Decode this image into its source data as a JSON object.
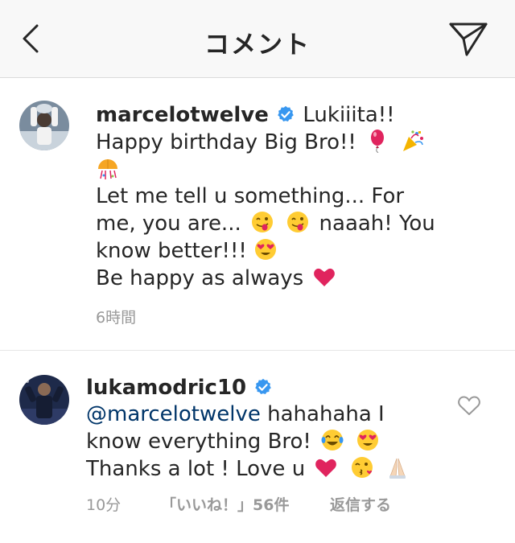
{
  "header": {
    "title": "コメント",
    "back_icon": "chevron-left-icon",
    "send_icon": "paper-plane-icon"
  },
  "colors": {
    "header_bg": "#f8f8f8",
    "text": "#262626",
    "meta": "#999999",
    "mention": "#003569",
    "verified": "#3897f0",
    "heart": "#e0245e"
  },
  "comments": [
    {
      "username": "marcelotwelve",
      "verified": true,
      "lines": [
        "Lukiiita!!",
        "Happy birthday Big Bro!!",
        "Let me tell u something... For",
        "me, you are...",
        "naaah! You",
        "know better!!!",
        "Be happy as always"
      ],
      "emojis": [
        "balloon",
        "party-popper",
        "confetti-ball",
        "winking-tongue-face",
        "winking-tongue-face",
        "heart-eyes-face",
        "red-heart"
      ],
      "time": "6時間"
    },
    {
      "username": "lukamodric10",
      "verified": true,
      "mention": "@marcelotwelve",
      "lines": [
        "hahahaha I",
        "know everything Bro!",
        "Thanks a lot ! Love u"
      ],
      "emojis": [
        "tears-of-joy-face",
        "heart-eyes-face",
        "red-heart",
        "kissing-face",
        "folded-hands"
      ],
      "time": "10分",
      "likes": "「いいね！」56件",
      "reply": "返信する"
    }
  ]
}
